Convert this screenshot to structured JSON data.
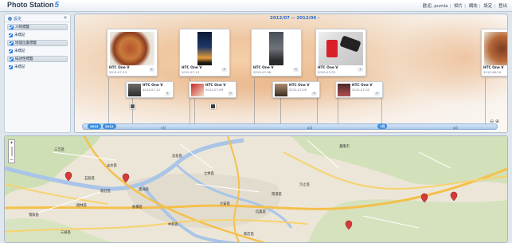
{
  "app": {
    "title": "Photo Station",
    "version_mark": "5"
  },
  "header": {
    "user_links": [
      "歡迎, pumla",
      "相片",
      "網誌",
      "設定",
      "登出"
    ]
  },
  "sidebar": {
    "settings_label": "設定",
    "collapse_glyph": "«",
    "groups": [
      {
        "label": "人物標籤",
        "items": [
          "未標記"
        ]
      },
      {
        "label": "地理位置標籤",
        "items": [
          "未標記"
        ]
      },
      {
        "label": "描述性標籤",
        "items": [
          "未標記"
        ]
      }
    ]
  },
  "timeline": {
    "date_range": "2012/07 -- 2012/06 -",
    "cards": [
      {
        "kind": "big",
        "camera": "HTC One V",
        "date": "2012-07-13",
        "count": "2"
      },
      {
        "kind": "small",
        "camera": "HTC One V",
        "date": "2012-07-12",
        "count": "1"
      },
      {
        "kind": "big",
        "camera": "HTC One V",
        "date": "2012-07-13",
        "count": "3"
      },
      {
        "kind": "small",
        "camera": "HTC One V",
        "date": "2012-07-09",
        "count": "2"
      },
      {
        "kind": "big",
        "camera": "HTC One V",
        "date": "2012-07-06",
        "count": "3"
      },
      {
        "kind": "small",
        "camera": "HTC One V",
        "date": "2012-07-05",
        "count": "4"
      },
      {
        "kind": "big",
        "camera": "HTC One V",
        "date": "2012-07-03",
        "count": "7"
      },
      {
        "kind": "small",
        "camera": "HTC One V",
        "date": "2012-07-02",
        "count": "2"
      },
      {
        "kind": "big",
        "camera": "HTC One V",
        "date": "2012-06-29",
        "count": ""
      }
    ],
    "bar": {
      "year_pills": [
        "2012",
        "2012",
        "7月"
      ],
      "labels": [
        "9月",
        "8月",
        "6月"
      ]
    },
    "zoom_icons": [
      "zoom-out",
      "zoom-in"
    ]
  },
  "map": {
    "zoom_in": "+",
    "zoom_out": "−",
    "labels": [
      "三芝區",
      "淡水區",
      "北投區",
      "士林區",
      "汐止區",
      "基隆市",
      "大安區",
      "中和區",
      "信義區",
      "新店區",
      "三峽區",
      "鶯歌區",
      "板橋區",
      "新莊區",
      "南港區",
      "樹林區",
      "蘆洲區",
      "五股區"
    ],
    "marker_color": "#d33a3a"
  }
}
